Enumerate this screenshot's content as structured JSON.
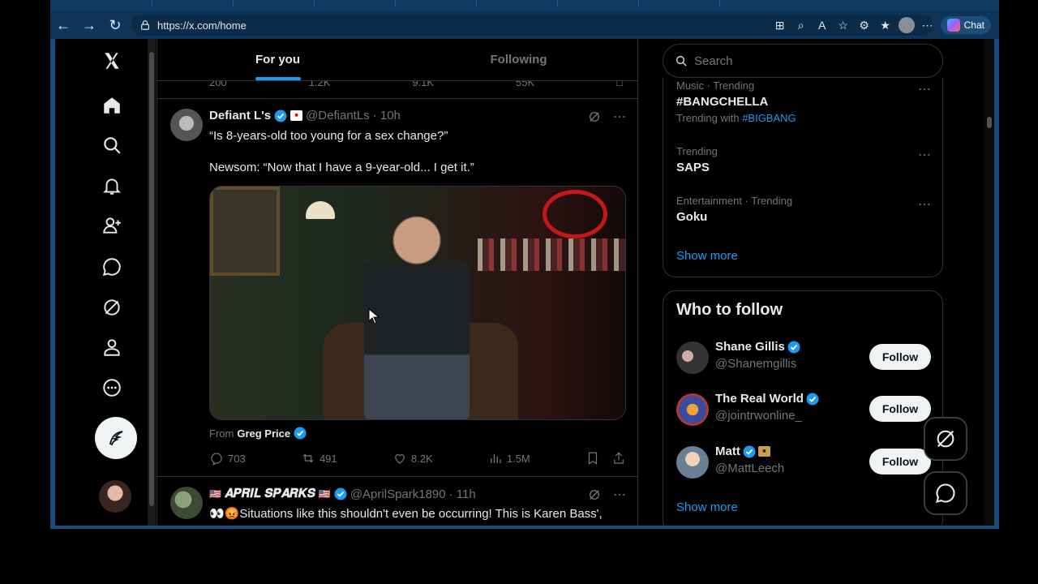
{
  "browser": {
    "url": "https://x.com/home",
    "chat_label": "Chat"
  },
  "tabs": {
    "for_you": "For you",
    "following": "Following"
  },
  "prev_tweet_stats": {
    "replies": "200",
    "reposts": "1.2K",
    "likes": "9.1K",
    "views": "55K"
  },
  "tweet1": {
    "name": "Defiant L's",
    "handle": "@DefiantLs",
    "time": "· 10h",
    "text_line1": "“Is 8-years-old too young for a sex change?”",
    "text_line2": "Newsom: “Now that I have a 9-year-old... I get it.”",
    "from_label": "From",
    "from_name": "Greg Price",
    "replies": "703",
    "reposts": "491",
    "likes": "8.2K",
    "views": "1.5M"
  },
  "tweet2": {
    "name": "𝑨𝑷𝑹𝑰𝑳 𝑺𝑷𝑨𝑹𝑲𝑺",
    "handle": "@AprilSpark1890",
    "time": "· 11h",
    "text": "👀😡Situations like this shouldn't even be occurring!  This is Karen Bass',"
  },
  "search": {
    "placeholder": "Search"
  },
  "trends": [
    {
      "meta": "Music · Trending",
      "title": "#BANGCHELLA",
      "sub_prefix": "Trending with",
      "sub_link": "#BIGBANG"
    },
    {
      "meta": "Trending",
      "title": "SAPS"
    },
    {
      "meta": "Entertainment · Trending",
      "title": "Goku"
    }
  ],
  "trends_show_more": "Show more",
  "who_to_follow": {
    "title": "Who to follow",
    "users": [
      {
        "name": "Shane Gillis",
        "handle": "@Shanemgillis",
        "button": "Follow"
      },
      {
        "name": "The Real World",
        "handle": "@jointrwonline_",
        "button": "Follow"
      },
      {
        "name": "Matt",
        "handle": "@MattLeech",
        "button": "Follow"
      }
    ],
    "show_more": "Show more"
  },
  "colors": {
    "accent": "#1d9bf0",
    "background": "#000000",
    "border": "#2f3336",
    "muted_text": "#71767b"
  }
}
